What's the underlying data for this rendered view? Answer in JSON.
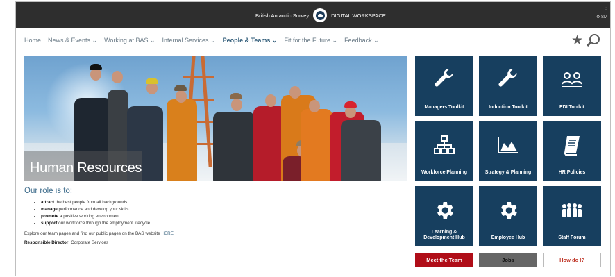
{
  "topbar": {
    "org": "British Antarctic Survey",
    "site": "DIGITAL WORKSPACE",
    "user_initials": "SM"
  },
  "nav": {
    "items": [
      {
        "label": "Home"
      },
      {
        "label": "News & Events ⌄"
      },
      {
        "label": "Working at BAS ⌄"
      },
      {
        "label": "Internal Services ⌄"
      },
      {
        "label": "People & Teams ⌄",
        "active": true
      },
      {
        "label": "Fit for the Future ⌄"
      },
      {
        "label": "Feedback ⌄"
      }
    ]
  },
  "hero": {
    "title": "Human Resources"
  },
  "role": {
    "heading": "Our role is to:",
    "bullets": [
      {
        "bold": "attract",
        "rest": " the best people from all backgrounds"
      },
      {
        "bold": "manage",
        "rest": " performance and develop your skills"
      },
      {
        "bold": "promote",
        "rest": " a positive working environment"
      },
      {
        "bold": "support",
        "rest": " our workforce through the employment lifecycle"
      }
    ],
    "explore_text": "Explore our team pages and find our public pages on the BAS website ",
    "explore_link": "HERE",
    "director_label": "Responsible Director:",
    "director_value": " Corporate Services"
  },
  "tiles": [
    {
      "label": "Managers Toolkit",
      "icon": "wrench-icon"
    },
    {
      "label": "Induction Toolkit",
      "icon": "wrench-icon"
    },
    {
      "label": "EDI Toolkit",
      "icon": "people-network-icon"
    },
    {
      "label": "Workforce Planning",
      "icon": "org-chart-icon"
    },
    {
      "label": "Strategy & Planning",
      "icon": "area-chart-icon"
    },
    {
      "label": "HR Policies",
      "icon": "book-icon"
    },
    {
      "label": "Learning & Development Hub",
      "icon": "gear-icon"
    },
    {
      "label": "Employee Hub",
      "icon": "gear-icon"
    },
    {
      "label": "Staff Forum",
      "icon": "group-icon"
    }
  ],
  "buttons": [
    {
      "label": "Meet the Team",
      "bg": "#b00d18",
      "fg": "#ffffff"
    },
    {
      "label": "Jobs",
      "bg": "#666666",
      "fg": "#111111"
    },
    {
      "label": "How do I?",
      "bg": "#ffffff",
      "fg": "#c0392b"
    }
  ],
  "colors": {
    "tile": "#173f5f",
    "topbar": "#2e2e2e",
    "accent": "#2f5b78"
  }
}
